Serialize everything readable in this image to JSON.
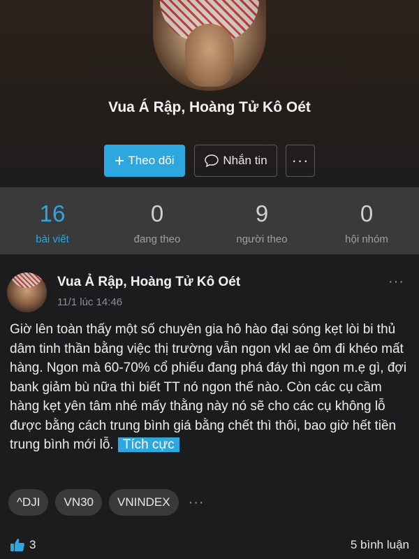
{
  "profile": {
    "name": "Vua Á Rập, Hoàng Tử Kô Oét",
    "follow_label": "Theo dõi",
    "message_label": "Nhắn tin",
    "more_label": "···"
  },
  "stats": [
    {
      "value": "16",
      "label": "bài viết",
      "active": true
    },
    {
      "value": "0",
      "label": "đang theo",
      "active": false
    },
    {
      "value": "9",
      "label": "người theo",
      "active": false
    },
    {
      "value": "0",
      "label": "hội nhóm",
      "active": false
    }
  ],
  "post": {
    "author": "Vua Ả Rập, Hoàng Tử Kô Oét",
    "time": "11/1 lúc 14:46",
    "more_label": "···",
    "body": "Giờ lên toàn thấy một số chuyên gia hô hào đại sóng kẹt lòi bi thủ dâm tinh thần bằng việc thị trường vẫn ngon vkl ae ôm đi khéo mất hàng. Ngon mà 60-70% cổ phiếu đang phá đáy thì ngon m.ẹ gì, đợi bank giảm bù nữa thì biết TT nó ngon thế nào. Còn các cụ cầm hàng kẹt yên tâm nhé mấy thằng này nó sẽ cho các cụ không lỗ được bằng cách trung bình giá bằng chết thì thôi, bao giờ hết tiền trung bình mới lỗ.",
    "sentiment": "Tích cực",
    "tags": [
      "^DJI",
      "VN30",
      "VNINDEX"
    ],
    "tags_more": "···",
    "likes": "3",
    "comments": "5 bình luận"
  },
  "colors": {
    "accent": "#2ea7e0",
    "background": "#1c1c1e",
    "stats_bg": "#3a3a3c"
  }
}
